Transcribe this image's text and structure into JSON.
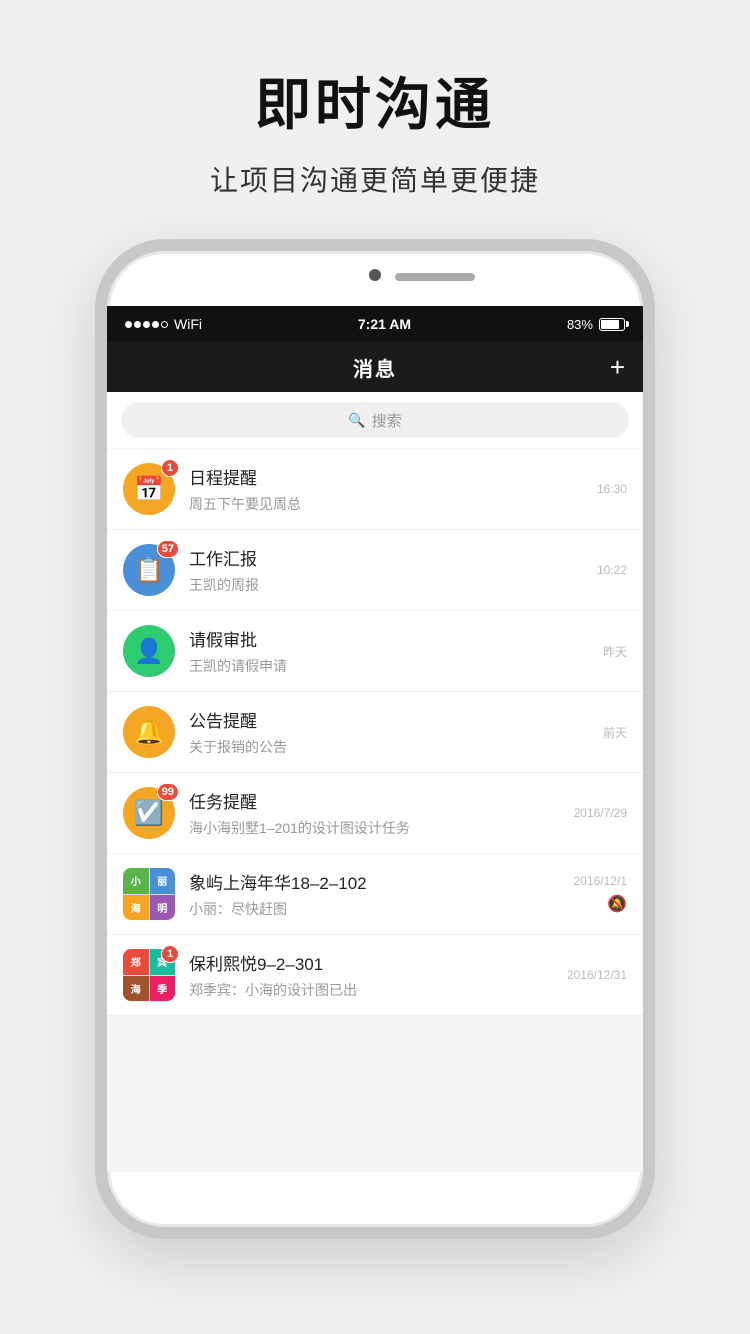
{
  "hero": {
    "title": "即时沟通",
    "subtitle": "让项目沟通更简单更便捷"
  },
  "statusBar": {
    "time": "7:21 AM",
    "battery": "83%"
  },
  "navBar": {
    "title": "消息",
    "plusLabel": "+"
  },
  "search": {
    "placeholder": "搜索",
    "icon": "🔍"
  },
  "messages": [
    {
      "id": "schedule",
      "avatarType": "calendar",
      "avatarIcon": "📅",
      "title": "日程提醒",
      "subtitle": "周五下午要见周总",
      "time": "16:30",
      "badge": "1",
      "muted": false
    },
    {
      "id": "report",
      "avatarType": "report",
      "avatarIcon": "📋",
      "title": "工作汇报",
      "subtitle": "王凯的周报",
      "time": "10:22",
      "badge": "57",
      "muted": false
    },
    {
      "id": "leave",
      "avatarType": "leave",
      "avatarIcon": "👤",
      "title": "请假审批",
      "subtitle": "王凯的请假申请",
      "time": "昨天",
      "badge": null,
      "muted": false
    },
    {
      "id": "notice",
      "avatarType": "notice",
      "avatarIcon": "🔔",
      "title": "公告提醒",
      "subtitle": "关于报销的公告",
      "time": "前天",
      "badge": null,
      "muted": false
    },
    {
      "id": "task",
      "avatarType": "task",
      "avatarIcon": "✅",
      "title": "任务提醒",
      "subtitle": "海小海别墅1–201的设计图设计任务",
      "time": "2016/7/29",
      "badge": "99",
      "muted": false
    },
    {
      "id": "group1",
      "avatarType": "group",
      "title": "象屿上海年华18–2–102",
      "subtitle": "小丽：尽快赶图",
      "time": "2016/12/1",
      "badge": null,
      "muted": true
    },
    {
      "id": "group2",
      "avatarType": "group2",
      "title": "保利熙悦9–2–301",
      "subtitle": "郑季宾：小海的设计图已出",
      "time": "2016/12/31",
      "badge": "1",
      "muted": false
    }
  ]
}
